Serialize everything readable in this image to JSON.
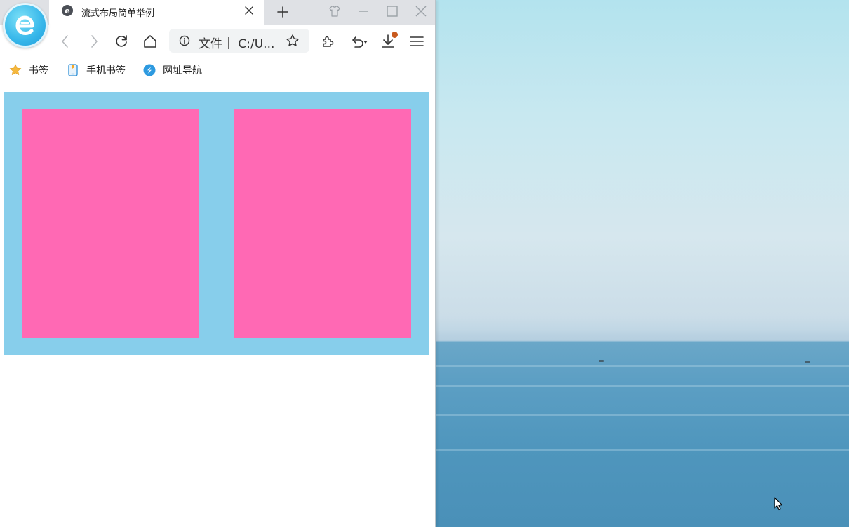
{
  "browser": {
    "tab": {
      "title": "流式布局简单举例",
      "favicon": "browser-e-icon"
    },
    "address": {
      "info_icon": "info-icon",
      "text": "文件｜ C:/U..."
    },
    "bookmarks": [
      {
        "label": "书签",
        "icon": "star-icon"
      },
      {
        "label": "手机书签",
        "icon": "phone-bookmark-icon"
      },
      {
        "label": "网址导航",
        "icon": "nav-compass-icon"
      }
    ],
    "toolbar_icons": [
      "back-icon",
      "forward-icon",
      "reload-icon",
      "home-icon",
      "extensions-icon",
      "undo-close-icon",
      "download-icon",
      "menu-icon"
    ],
    "window_controls": [
      "skin-icon",
      "minimize-icon",
      "maximize-icon",
      "close-window-icon"
    ]
  },
  "page": {
    "colors": {
      "container": "#87ceeb",
      "box": "#ff69b4"
    },
    "boxes": 2
  },
  "desktop": {
    "wallpaper": "ocean-horizon"
  }
}
